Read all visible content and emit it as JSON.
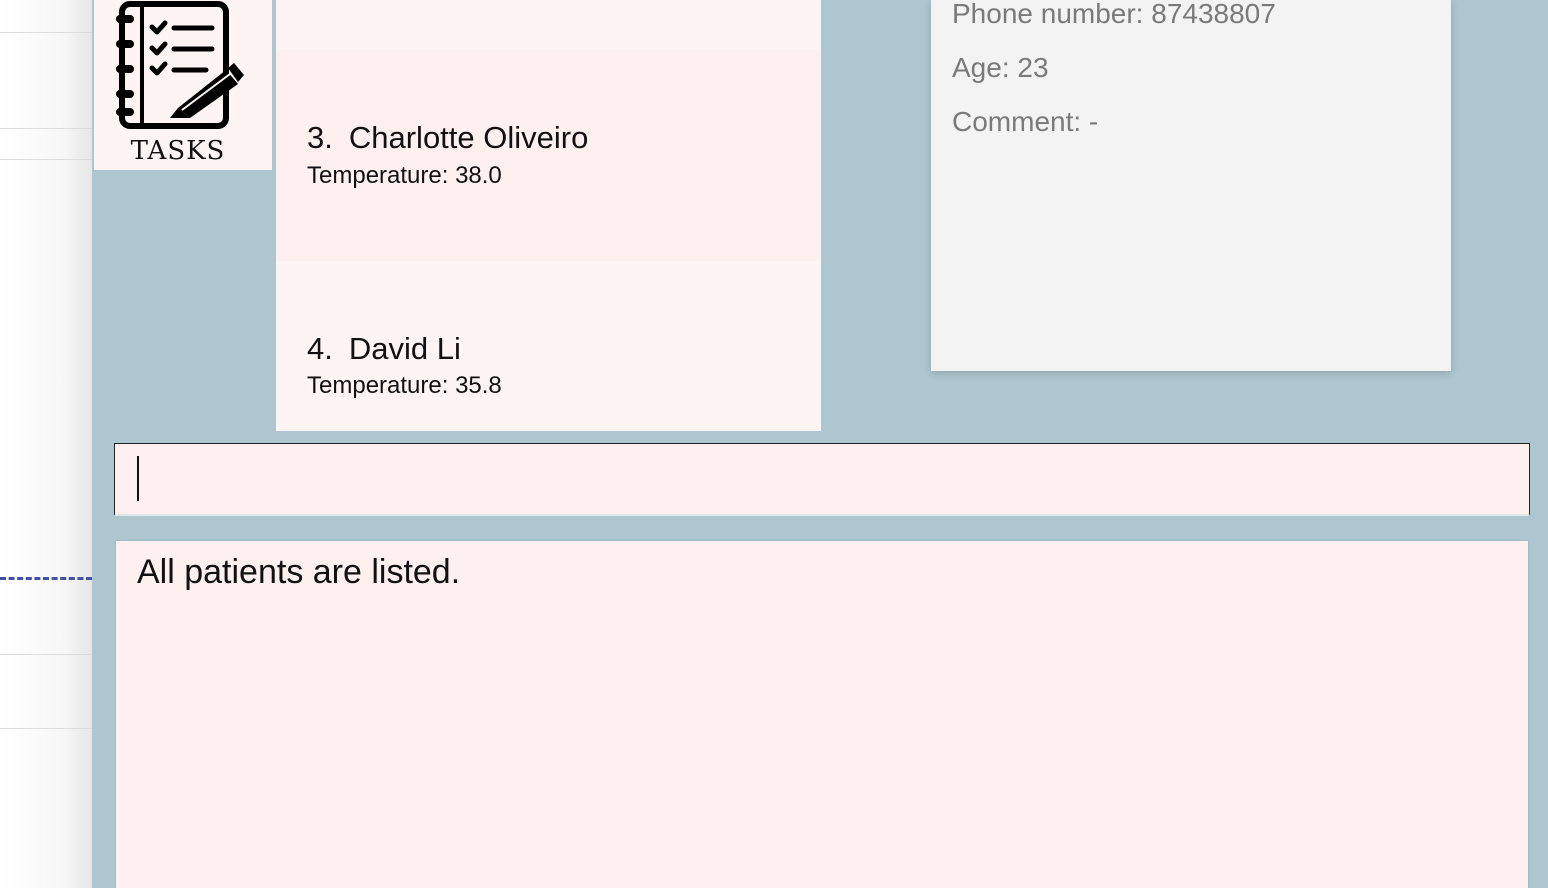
{
  "tasks_button": {
    "label": "TASKS"
  },
  "patients": [
    {
      "index": "3.",
      "name": "Charlotte Oliveiro",
      "temperature": "Temperature: 38.0"
    },
    {
      "index": "4.",
      "name": "David Li",
      "temperature": "Temperature: 35.8"
    }
  ],
  "patient_detail": {
    "phone": "Phone number: 87438807",
    "age": "Age: 23",
    "comment": "Comment: -"
  },
  "command_box": {
    "value": ""
  },
  "result_display": {
    "message": "All patients are listed."
  },
  "colors": {
    "background": "#adc6d0",
    "card_pink": "#fff0f0",
    "detail_gray": "#f3f3f3"
  }
}
